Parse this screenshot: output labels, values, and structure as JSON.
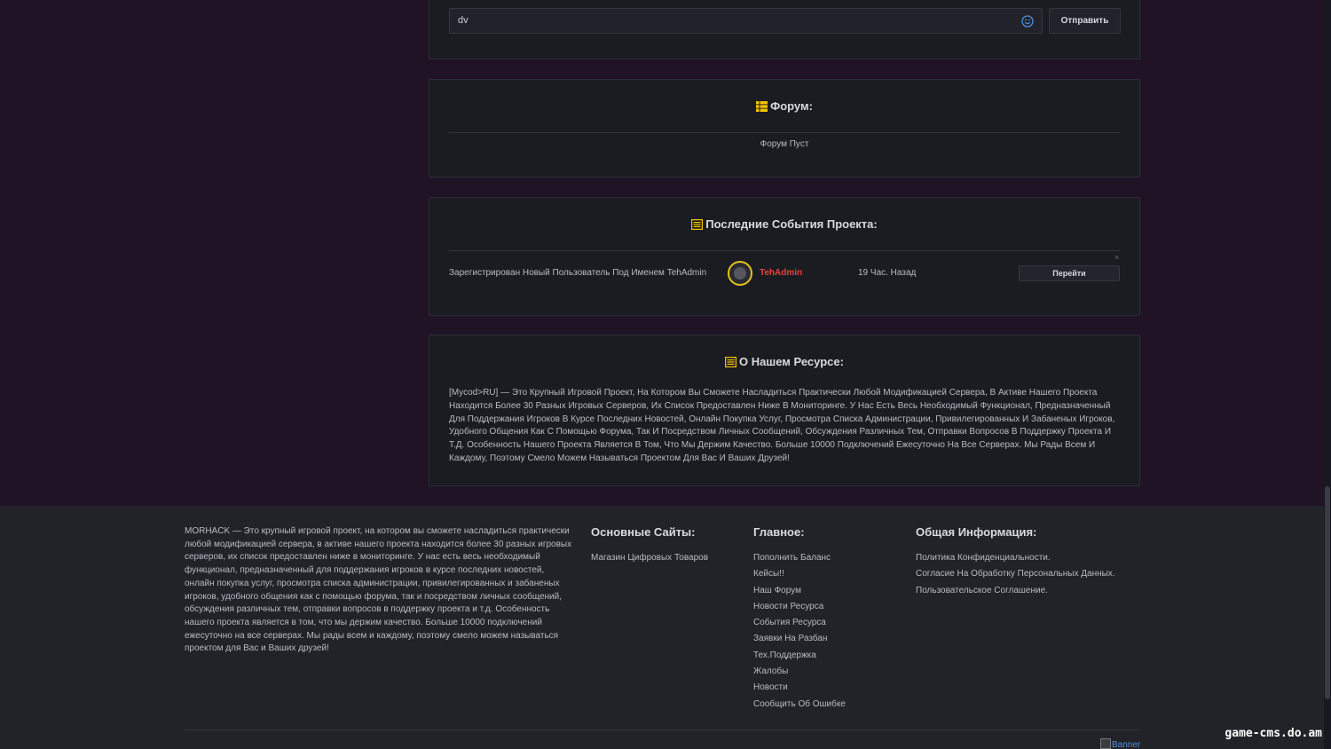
{
  "chat": {
    "input_value": "dv",
    "send_label": "Отправить"
  },
  "forum": {
    "title": "Форум:",
    "empty_text": "Форум Пуст"
  },
  "events": {
    "title": "Последние События Проекта:",
    "items": [
      {
        "text": "Зарегистрирован Новый Пользователь Под Именем TehAdmin",
        "user": "TehAdmin",
        "time": "19 Час. Назад",
        "button": "Перейти",
        "close": "×"
      }
    ]
  },
  "about": {
    "title": "О Нашем Ресурсе:",
    "text": "[Mycod>RU] — Это Крупный Игровой Проект, На Котором Вы Сможете Насладиться Практически Любой Модификацией Сервера, В Активе Нашего Проекта Находится Более 30 Разных Игровых Серверов, Их Список Предоставлен Ниже В Мониторинге. У Нас Есть Весь Необходимый Функционал, Предназначенный Для Поддержания Игроков В Курсе Последних Новостей, Онлайн Покупка Услуг, Просмотра Списка Администрации, Привилегированных И Забаненых Игроков, Удобного Общения Как С Помощью Форума, Так И Посредством Личных Сообщений, Обсуждения Различных Тем, Отправки Вопросов В Поддержку Проекта И Т.Д. Особенность Нашего Проекта Является В Том, Что Мы Держим Качество. Больше 10000 Подключений Ежесуточно На Все Серверах. Мы Рады Всем И Каждому, Поэтому Смело Можем Называться Проектом Для Вас И Ваших Друзей!"
  },
  "footer": {
    "about_text": "MORHACK — Это крупный игровой проект, на котором вы сможете насладиться практически любой модификацией сервера, в активе нашего проекта находится более 30 разных игровых серверов, их список предоставлен ниже в мониторинге. У нас есть весь необходимый функционал, предназначенный для поддержания игроков в курсе последних новостей, онлайн покупка услуг, просмотра списка администрации, привилегированных и забаненых игроков, удобного общения как с помощью форума, так и посредством личных сообщений, обсуждения различных тем, отправки вопросов в поддержку проекта и т.д. Особенность нашего проекта является в том, что мы держим качество. Больше 10000 подключений ежесуточно на все серверах. Мы рады всем и каждому, поэтому смело можем называться проектом для Вас и Ваших друзей!",
    "sites": {
      "title": "Основные Сайты:",
      "links": [
        "Магазин Цифровых Товаров"
      ]
    },
    "main": {
      "title": "Главное:",
      "links": [
        "Пополнить Баланс",
        "Кейсы!!",
        "Наш Форум",
        "Новости Ресурса",
        "События Ресурса",
        "Заявки На Разбан",
        "Тех.Поддержка",
        "Жалобы",
        "Новости",
        "Сообщить Об Ошибке"
      ]
    },
    "info": {
      "title": "Общая Информация:",
      "links": [
        "Политика Конфиденциальности.",
        "Согласие На Обработку Персональных Данных.",
        "Пользовательское Соглашение."
      ]
    },
    "banner_alt": "Banner"
  },
  "watermark": "game-cms.do.am",
  "colors": {
    "background": "#1f1325",
    "card": "#1b1c22",
    "accent_yellow": "#f2c200",
    "username_red": "#e3413a",
    "footer": "#222329"
  }
}
